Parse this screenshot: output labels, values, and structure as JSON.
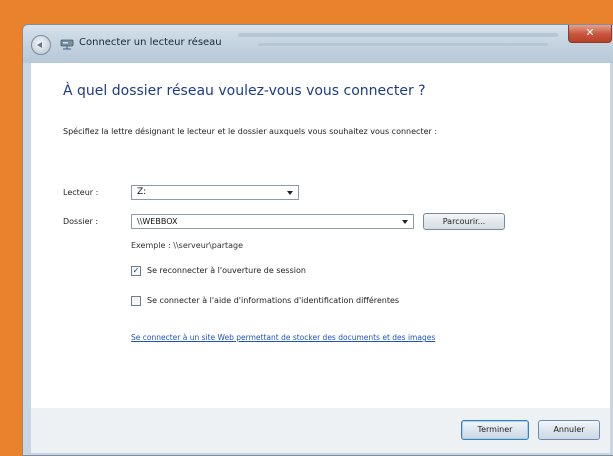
{
  "window": {
    "title": "Connecter un lecteur réseau",
    "close_glyph": "✕"
  },
  "dialog": {
    "heading": "À quel dossier réseau voulez-vous vous connecter ?",
    "instructions": "Spécifiez la lettre désignant le lecteur et le dossier auxquels vous souhaitez vous connecter :",
    "drive_label": "Lecteur :",
    "drive_value": "Z:",
    "folder_label": "Dossier :",
    "folder_value": "\\\\WEBBOX",
    "browse_label": "Parcourir...",
    "example": "Exemple : \\\\serveur\\partage",
    "reconnect_label": "Se reconnecter à l'ouverture de session",
    "reconnect_checked": "✓",
    "other_creds_label": "Se connecter à l'aide d'informations d'identification différentes",
    "other_creds_checked": "",
    "link_text": "Se connecter à un site Web permettant de stocker des documents et des images"
  },
  "footer": {
    "finish_label": "Terminer",
    "cancel_label": "Annuler"
  },
  "colors": {
    "background": "#e9822c",
    "heading": "#1e3b8a",
    "link": "#1e55b8",
    "close": "#c9533a"
  },
  "icons": {
    "back": "back-arrow-icon",
    "network_drive": "network-drive-icon",
    "combo": "chevron-down-icon"
  }
}
